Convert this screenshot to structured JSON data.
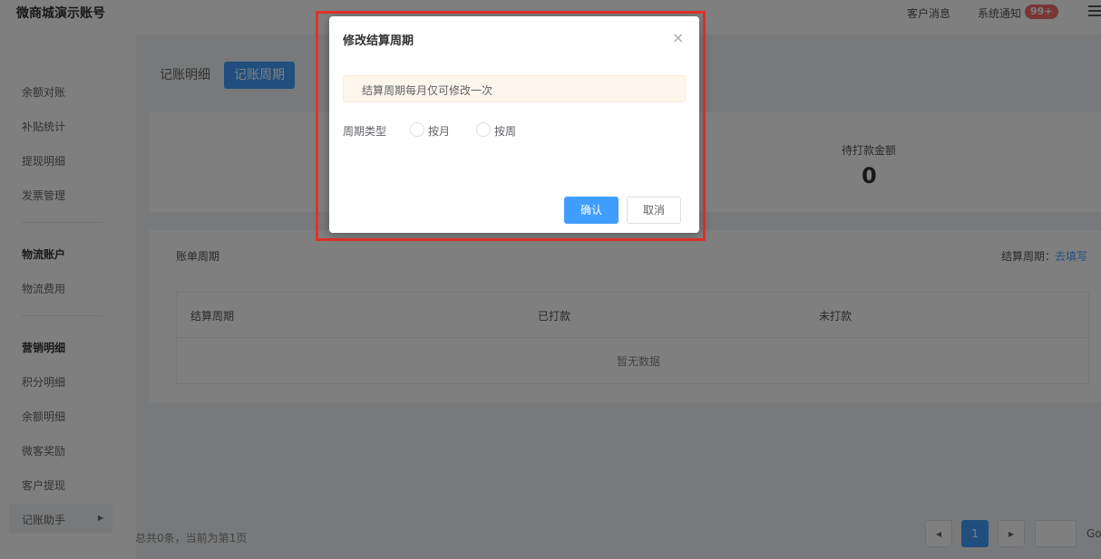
{
  "header": {
    "app_title": "微商城演示账号",
    "customer_messages": "客户消息",
    "system_notice": "系统通知",
    "notice_badge": "99+"
  },
  "sidebar": {
    "items_top": [
      "余额对账",
      "补贴统计",
      "提现明细",
      "发票管理"
    ],
    "group_logistics": "物流账户",
    "logistics_items": [
      "物流费用"
    ],
    "group_marketing": "营销明细",
    "marketing_items": [
      "积分明细",
      "余额明细",
      "微客奖励",
      "客户提现",
      "记账助手"
    ]
  },
  "tabs": [
    "记账明细",
    "记账周期"
  ],
  "stats": {
    "pending_label": "待打款金额",
    "pending_value": "0"
  },
  "bill_section": {
    "title": "账单周期",
    "settle_label": "结算周期：",
    "settle_link": "去填写",
    "columns": [
      "结算周期",
      "已打款",
      "未打款"
    ],
    "empty_text": "暂无数据"
  },
  "pagination": {
    "summary": "总共0条，当前为第1页",
    "current_page": "1",
    "go_label": "Go"
  },
  "dialog": {
    "title": "修改结算周期",
    "close_glyph": "×",
    "notice": "结算周期每月仅可修改一次",
    "field_label": "周期类型",
    "options": [
      "按月",
      "按周"
    ],
    "confirm_label": "确认",
    "cancel_label": "取消"
  },
  "colors": {
    "primary": "#409eff",
    "highlight": "#e5302a",
    "badge": "#f56c6c"
  }
}
